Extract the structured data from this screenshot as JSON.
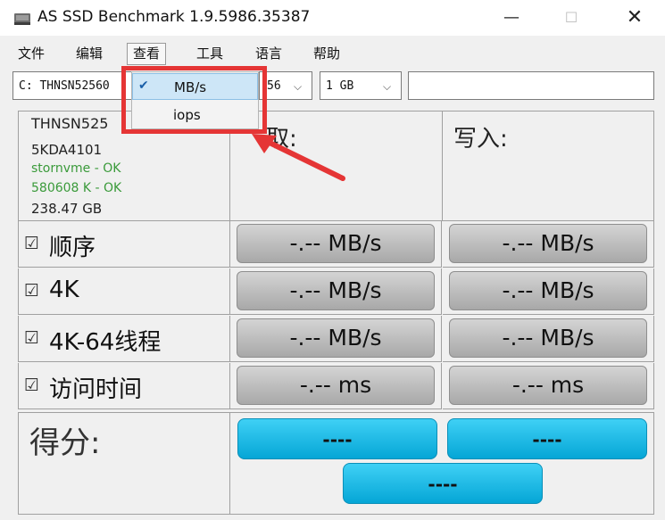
{
  "window": {
    "title": "AS SSD Benchmark 1.9.5986.35387",
    "minimize": "—",
    "maximize": "☐",
    "close": "✕"
  },
  "menu": {
    "items": [
      "文件",
      "编辑",
      "查看",
      "工具",
      "语言",
      "帮助"
    ],
    "active_index": 2
  },
  "toolbar": {
    "drive_select": "C: THNSN52560",
    "block_select_partial": "56",
    "size_select": "1 GB",
    "text_field": ""
  },
  "dropdown": {
    "items": [
      {
        "label": "MB/s",
        "checked": true
      },
      {
        "label": "iops",
        "checked": false
      }
    ]
  },
  "drive_info": {
    "model": "THNSN525",
    "firmware": "5KDA4101",
    "driver": "stornvme - OK",
    "alignment": "580608 K - OK",
    "capacity": "238.47 GB"
  },
  "columns": {
    "read": "取:",
    "write": "写入:"
  },
  "tests": [
    {
      "label": "顺序",
      "checked": "☑",
      "read": "-.-- MB/s",
      "write": "-.-- MB/s"
    },
    {
      "label": "4K",
      "checked": "☑",
      "read": "-.-- MB/s",
      "write": "-.-- MB/s"
    },
    {
      "label": "4K-64线程",
      "checked": "☑",
      "read": "-.-- MB/s",
      "write": "-.-- MB/s"
    },
    {
      "label": "访问时间",
      "checked": "☑",
      "read": "-.-- ms",
      "write": "-.-- ms"
    }
  ],
  "score": {
    "label": "得分:",
    "read": "----",
    "write": "----",
    "total": "----"
  },
  "colors": {
    "highlight": "#e53535",
    "score_button": "#05a6d6",
    "ok_text": "#3a9a3a"
  }
}
